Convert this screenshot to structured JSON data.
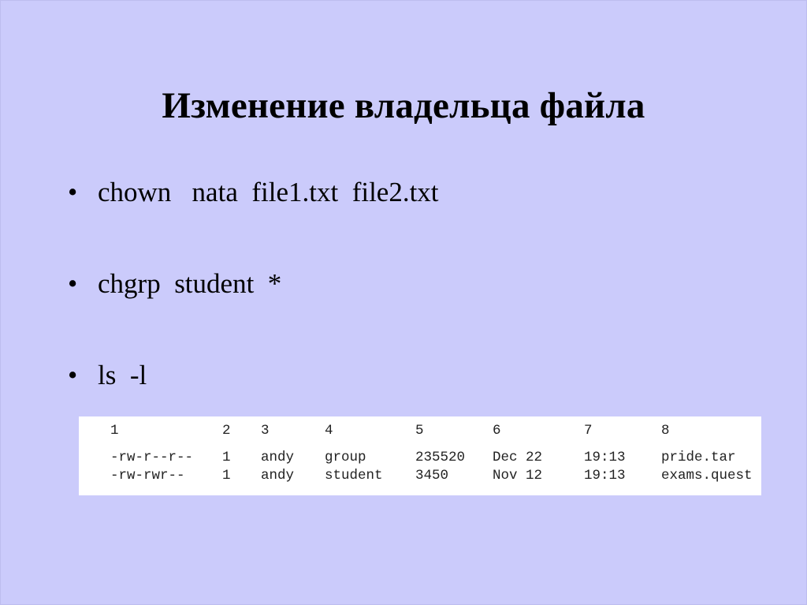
{
  "slide": {
    "title": "Изменение владельца файла",
    "bullets": [
      {
        "symbol": "•",
        "text": "chown   nata  file1.txt  file2.txt"
      },
      {
        "symbol": "•",
        "text": "chgrp  student  *"
      },
      {
        "symbol": "•",
        "text": "ls  -l"
      }
    ],
    "ls_output": {
      "column_numbers": [
        "1",
        "2",
        "3",
        "4",
        "5",
        "6",
        "7",
        "8"
      ],
      "rows": [
        [
          "-rw-r--r--",
          "1",
          "andy",
          "group",
          "235520",
          "Dec 22",
          "19:13",
          "pride.tar"
        ],
        [
          "-rw-rwr--",
          "1",
          "andy",
          "student",
          "3450",
          "Nov 12",
          "19:13",
          "exams.quest"
        ]
      ]
    }
  }
}
